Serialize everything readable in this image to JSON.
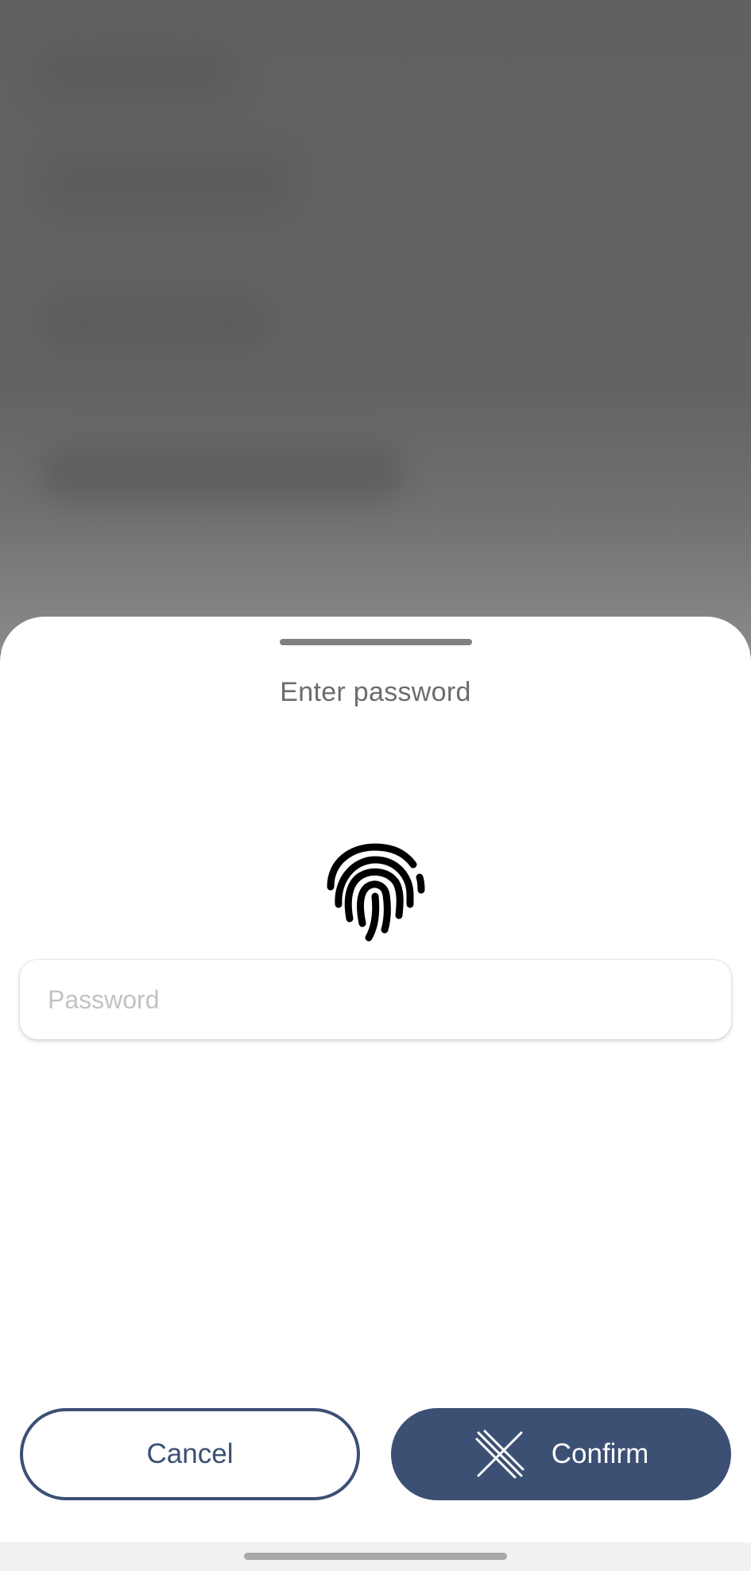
{
  "sheet": {
    "title": "Enter password"
  },
  "fingerprint": {
    "icon": "fingerprint-icon"
  },
  "password": {
    "placeholder": "Password",
    "value": ""
  },
  "actions": {
    "cancel_label": "Cancel",
    "confirm_label": "Confirm",
    "confirm_icon": "x-logo-icon"
  },
  "colors": {
    "primary": "#3c5074",
    "backdrop": "#636363",
    "title": "#6c6c6c",
    "placeholder": "#c2c2c2"
  }
}
